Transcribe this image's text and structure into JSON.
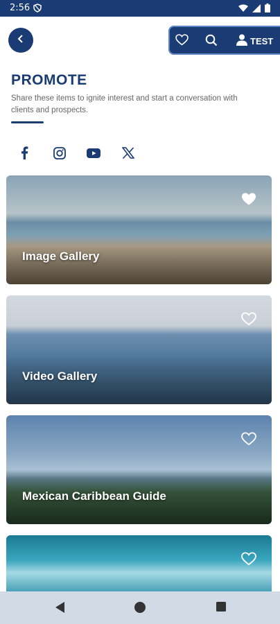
{
  "status_bar": {
    "time": "2:56"
  },
  "header": {
    "user_label": "TEST"
  },
  "page": {
    "title": "PROMOTE",
    "subtitle": "Share these items to ignite interest and start a conversation with clients and prospects."
  },
  "social": [
    {
      "name": "facebook-icon"
    },
    {
      "name": "instagram-icon"
    },
    {
      "name": "youtube-icon"
    },
    {
      "name": "x-icon"
    }
  ],
  "cards": [
    {
      "title": "Image Gallery"
    },
    {
      "title": "Video Gallery"
    },
    {
      "title": "Mexican Caribbean Guide"
    },
    {
      "title": ""
    }
  ],
  "colors": {
    "primary": "#1a3b73",
    "nav_bg": "#d2dae6",
    "subtitle": "#666666"
  }
}
